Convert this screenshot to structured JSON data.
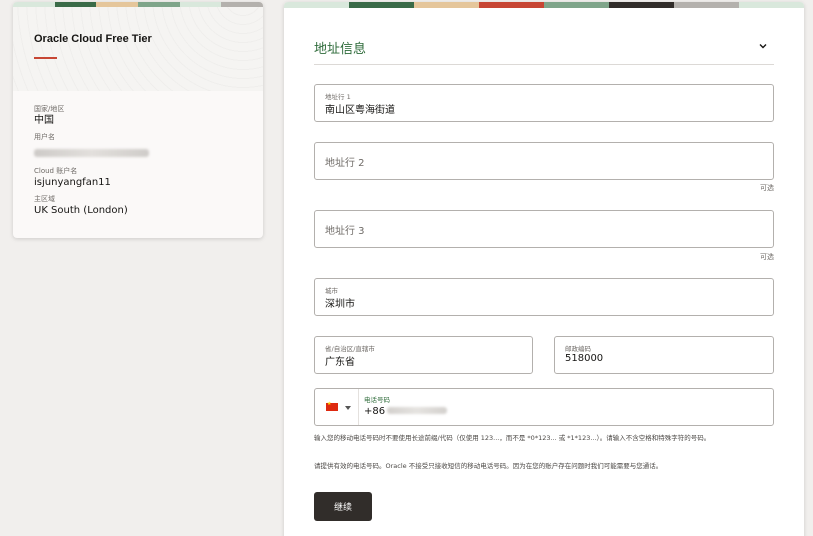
{
  "colors": {
    "accent_red": "#c74634",
    "section_green": "#2e6b3a",
    "button_dark": "#312d2a",
    "stripe": [
      "#d9e8dc",
      "#3a6b48",
      "#e5c69b",
      "#c74634",
      "#7fa58a",
      "#b4b1ad",
      "#d9e8dc",
      "#312d2a"
    ]
  },
  "account": {
    "title": "Oracle Cloud Free Tier",
    "country_label": "国家/地区",
    "country_value": "中国",
    "username_label": "用户名",
    "cloud_account_label": "Cloud 账户名",
    "cloud_account_value": "isjunyangfan11",
    "home_region_label": "主区域",
    "home_region_value": "UK South (London)"
  },
  "address": {
    "section_title": "地址信息",
    "optional_text": "可选",
    "line1_label": "地址行 1",
    "line1_value": "南山区粤海街道",
    "line2_placeholder": "地址行 2",
    "line3_placeholder": "地址行 3",
    "city_label": "城市",
    "city_value": "深圳市",
    "province_label": "省/自治区/直辖市",
    "province_value": "广东省",
    "postal_label": "邮政编码",
    "postal_value": "518000",
    "phone_label": "电话号码",
    "phone_prefix": "+86",
    "phone_country_icon": "china-flag-icon",
    "help_text_1": "输入您的移动电话号码时不要使用长途前缀/代码（仅使用 123...，而不是 *0*123... 或 *1*123...）。请输入不含空格和特殊字符的号码。",
    "help_text_2": "请提供有效的电话号码。Oracle 不接受只接收短信的移动电话号码。因为在您的账户存在问题时我们可能需要与您通话。",
    "continue_label": "继续"
  }
}
